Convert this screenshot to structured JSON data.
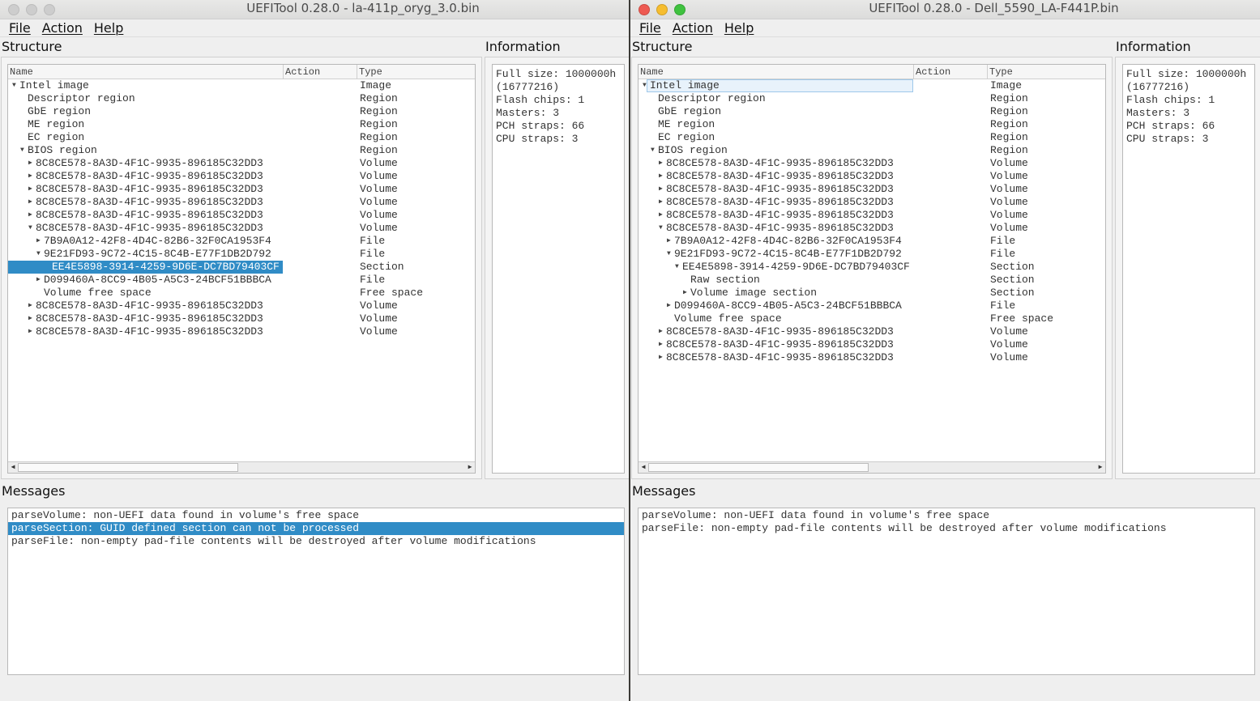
{
  "windows": [
    {
      "title": "UEFITool 0.28.0 - la-411p_oryg_3.0.bin",
      "active": false,
      "menu": [
        "File",
        "Action",
        "Help"
      ],
      "labels": {
        "structure": "Structure",
        "information": "Information",
        "messages": "Messages"
      },
      "columns": [
        "Name",
        "Action",
        "Type"
      ],
      "tree": [
        {
          "name": "Intel image",
          "type": "Image",
          "depth": 0,
          "arrow": "down"
        },
        {
          "name": "Descriptor region",
          "type": "Region",
          "depth": 1,
          "arrow": ""
        },
        {
          "name": "GbE region",
          "type": "Region",
          "depth": 1,
          "arrow": ""
        },
        {
          "name": "ME region",
          "type": "Region",
          "depth": 1,
          "arrow": ""
        },
        {
          "name": "EC region",
          "type": "Region",
          "depth": 1,
          "arrow": ""
        },
        {
          "name": "BIOS region",
          "type": "Region",
          "depth": 1,
          "arrow": "down"
        },
        {
          "name": "8C8CE578-8A3D-4F1C-9935-896185C32DD3",
          "type": "Volume",
          "depth": 2,
          "arrow": "right"
        },
        {
          "name": "8C8CE578-8A3D-4F1C-9935-896185C32DD3",
          "type": "Volume",
          "depth": 2,
          "arrow": "right"
        },
        {
          "name": "8C8CE578-8A3D-4F1C-9935-896185C32DD3",
          "type": "Volume",
          "depth": 2,
          "arrow": "right"
        },
        {
          "name": "8C8CE578-8A3D-4F1C-9935-896185C32DD3",
          "type": "Volume",
          "depth": 2,
          "arrow": "right"
        },
        {
          "name": "8C8CE578-8A3D-4F1C-9935-896185C32DD3",
          "type": "Volume",
          "depth": 2,
          "arrow": "right"
        },
        {
          "name": "8C8CE578-8A3D-4F1C-9935-896185C32DD3",
          "type": "Volume",
          "depth": 2,
          "arrow": "down"
        },
        {
          "name": "7B9A0A12-42F8-4D4C-82B6-32F0CA1953F4",
          "type": "File",
          "depth": 3,
          "arrow": "right"
        },
        {
          "name": "9E21FD93-9C72-4C15-8C4B-E77F1DB2D792",
          "type": "File",
          "depth": 3,
          "arrow": "down"
        },
        {
          "name": "EE4E5898-3914-4259-9D6E-DC7BD79403CF",
          "type": "Section",
          "depth": 4,
          "arrow": "",
          "state": "sel"
        },
        {
          "name": "D099460A-8CC9-4B05-A5C3-24BCF51BBBCA",
          "type": "File",
          "depth": 3,
          "arrow": "right"
        },
        {
          "name": "Volume free space",
          "type": "Free space",
          "depth": 3,
          "arrow": ""
        },
        {
          "name": "8C8CE578-8A3D-4F1C-9935-896185C32DD3",
          "type": "Volume",
          "depth": 2,
          "arrow": "right"
        },
        {
          "name": "8C8CE578-8A3D-4F1C-9935-896185C32DD3",
          "type": "Volume",
          "depth": 2,
          "arrow": "right"
        },
        {
          "name": "8C8CE578-8A3D-4F1C-9935-896185C32DD3",
          "type": "Volume",
          "depth": 2,
          "arrow": "right"
        }
      ],
      "info": [
        "Full size: 1000000h",
        "(16777216)",
        "Flash chips: 1",
        "Masters: 3",
        "PCH straps: 66",
        "CPU straps: 3"
      ],
      "messages": [
        {
          "text": "parseVolume: non-UEFI data found in volume's free space"
        },
        {
          "text": "parseSection: GUID defined section can not be processed",
          "selected": true
        },
        {
          "text": "parseFile: non-empty pad-file contents will be destroyed after volume modifications"
        }
      ]
    },
    {
      "title": "UEFITool 0.28.0 - Dell_5590_LA-F441P.bin",
      "active": true,
      "menu": [
        "File",
        "Action",
        "Help"
      ],
      "labels": {
        "structure": "Structure",
        "information": "Information",
        "messages": "Messages"
      },
      "columns": [
        "Name",
        "Action",
        "Type"
      ],
      "tree": [
        {
          "name": "Intel image",
          "type": "Image",
          "depth": 0,
          "arrow": "down",
          "state": "focus"
        },
        {
          "name": "Descriptor region",
          "type": "Region",
          "depth": 1,
          "arrow": ""
        },
        {
          "name": "GbE region",
          "type": "Region",
          "depth": 1,
          "arrow": ""
        },
        {
          "name": "ME region",
          "type": "Region",
          "depth": 1,
          "arrow": ""
        },
        {
          "name": "EC region",
          "type": "Region",
          "depth": 1,
          "arrow": ""
        },
        {
          "name": "BIOS region",
          "type": "Region",
          "depth": 1,
          "arrow": "down"
        },
        {
          "name": "8C8CE578-8A3D-4F1C-9935-896185C32DD3",
          "type": "Volume",
          "depth": 2,
          "arrow": "right"
        },
        {
          "name": "8C8CE578-8A3D-4F1C-9935-896185C32DD3",
          "type": "Volume",
          "depth": 2,
          "arrow": "right"
        },
        {
          "name": "8C8CE578-8A3D-4F1C-9935-896185C32DD3",
          "type": "Volume",
          "depth": 2,
          "arrow": "right"
        },
        {
          "name": "8C8CE578-8A3D-4F1C-9935-896185C32DD3",
          "type": "Volume",
          "depth": 2,
          "arrow": "right"
        },
        {
          "name": "8C8CE578-8A3D-4F1C-9935-896185C32DD3",
          "type": "Volume",
          "depth": 2,
          "arrow": "right"
        },
        {
          "name": "8C8CE578-8A3D-4F1C-9935-896185C32DD3",
          "type": "Volume",
          "depth": 2,
          "arrow": "down"
        },
        {
          "name": "7B9A0A12-42F8-4D4C-82B6-32F0CA1953F4",
          "type": "File",
          "depth": 3,
          "arrow": "right"
        },
        {
          "name": "9E21FD93-9C72-4C15-8C4B-E77F1DB2D792",
          "type": "File",
          "depth": 3,
          "arrow": "down"
        },
        {
          "name": "EE4E5898-3914-4259-9D6E-DC7BD79403CF",
          "type": "Section",
          "depth": 4,
          "arrow": "down"
        },
        {
          "name": "Raw section",
          "type": "Section",
          "depth": 5,
          "arrow": ""
        },
        {
          "name": "Volume image section",
          "type": "Section",
          "depth": 5,
          "arrow": "right"
        },
        {
          "name": "D099460A-8CC9-4B05-A5C3-24BCF51BBBCA",
          "type": "File",
          "depth": 3,
          "arrow": "right"
        },
        {
          "name": "Volume free space",
          "type": "Free space",
          "depth": 3,
          "arrow": ""
        },
        {
          "name": "8C8CE578-8A3D-4F1C-9935-896185C32DD3",
          "type": "Volume",
          "depth": 2,
          "arrow": "right"
        },
        {
          "name": "8C8CE578-8A3D-4F1C-9935-896185C32DD3",
          "type": "Volume",
          "depth": 2,
          "arrow": "right"
        },
        {
          "name": "8C8CE578-8A3D-4F1C-9935-896185C32DD3",
          "type": "Volume",
          "depth": 2,
          "arrow": "right"
        }
      ],
      "info": [
        "Full size: 1000000h",
        "(16777216)",
        "Flash chips: 1",
        "Masters: 3",
        "PCH straps: 66",
        "CPU straps: 3"
      ],
      "messages": [
        {
          "text": "parseVolume: non-UEFI data found in volume's free space"
        },
        {
          "text": "parseFile: non-empty pad-file contents will be destroyed after volume modifications"
        }
      ]
    }
  ]
}
